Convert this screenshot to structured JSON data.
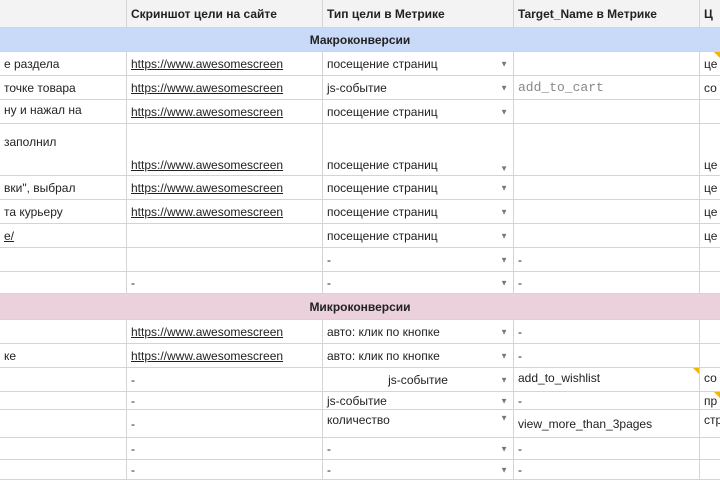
{
  "header": [
    "",
    "Скриншот цели на сайте",
    "Тип цели в Метрике",
    "Target_Name в Метрике",
    "Ц"
  ],
  "sections": {
    "macro": "Макроконверсии",
    "micro": "Микроконверсии"
  },
  "macro_rows": [
    {
      "c0": "е раздела",
      "c1": "https://www.awesomescreen",
      "c2": "посещение страниц",
      "c3": "",
      "c4": "це"
    },
    {
      "c0": "точке товара",
      "c1": "https://www.awesomescreen",
      "c2": "js-событие",
      "c3": "add_to_cart",
      "c4": "со"
    },
    {
      "c0": "ну и нажал на",
      "c1": "https://www.awesomescreen",
      "c2": "посещение страниц",
      "c3": "",
      "c4": ""
    },
    {
      "c0": "заполнил",
      "c1": "https://www.awesomescreen",
      "c2": "посещение страниц",
      "c3": "",
      "c4": "це"
    },
    {
      "c0": "вки\", выбрал",
      "c1": "https://www.awesomescreen",
      "c2": "посещение страниц",
      "c3": "",
      "c4": "це"
    },
    {
      "c0": "та курьеру",
      "c1": "https://www.awesomescreen",
      "c2": "посещение страниц",
      "c3": "",
      "c4": "це"
    },
    {
      "c0": "e/",
      "c1": "",
      "c2": "посещение страниц",
      "c3": "",
      "c4": "це"
    },
    {
      "c0": "",
      "c1": "",
      "c2": "-",
      "c3": "-",
      "c4": ""
    },
    {
      "c0": "",
      "c1": "-",
      "c2": "-",
      "c3": "-",
      "c4": ""
    }
  ],
  "micro_rows": [
    {
      "c0": "",
      "c1": "https://www.awesomescreen",
      "c2": "авто: клик по кнопке",
      "c3": "-",
      "c4": ""
    },
    {
      "c0": "ке",
      "c1": "https://www.awesomescreen",
      "c2": "авто: клик по кнопке",
      "c3": "-",
      "c4": ""
    },
    {
      "c0": "",
      "c1": "-",
      "c2": "js-событие",
      "c3": "add_to_wishlist",
      "c4": "со"
    },
    {
      "c0": "",
      "c1": "-",
      "c2": "js-событие",
      "c3": "-",
      "c4": "пр"
    },
    {
      "c0": "",
      "c1": "-",
      "c2": "количество",
      "c3": "view_more_than_3pages",
      "c4": "стр"
    },
    {
      "c0": "",
      "c1": "-",
      "c2": "-",
      "c3": "-",
      "c4": ""
    },
    {
      "c0": "",
      "c1": "-",
      "c2": "-",
      "c3": "-",
      "c4": ""
    }
  ]
}
